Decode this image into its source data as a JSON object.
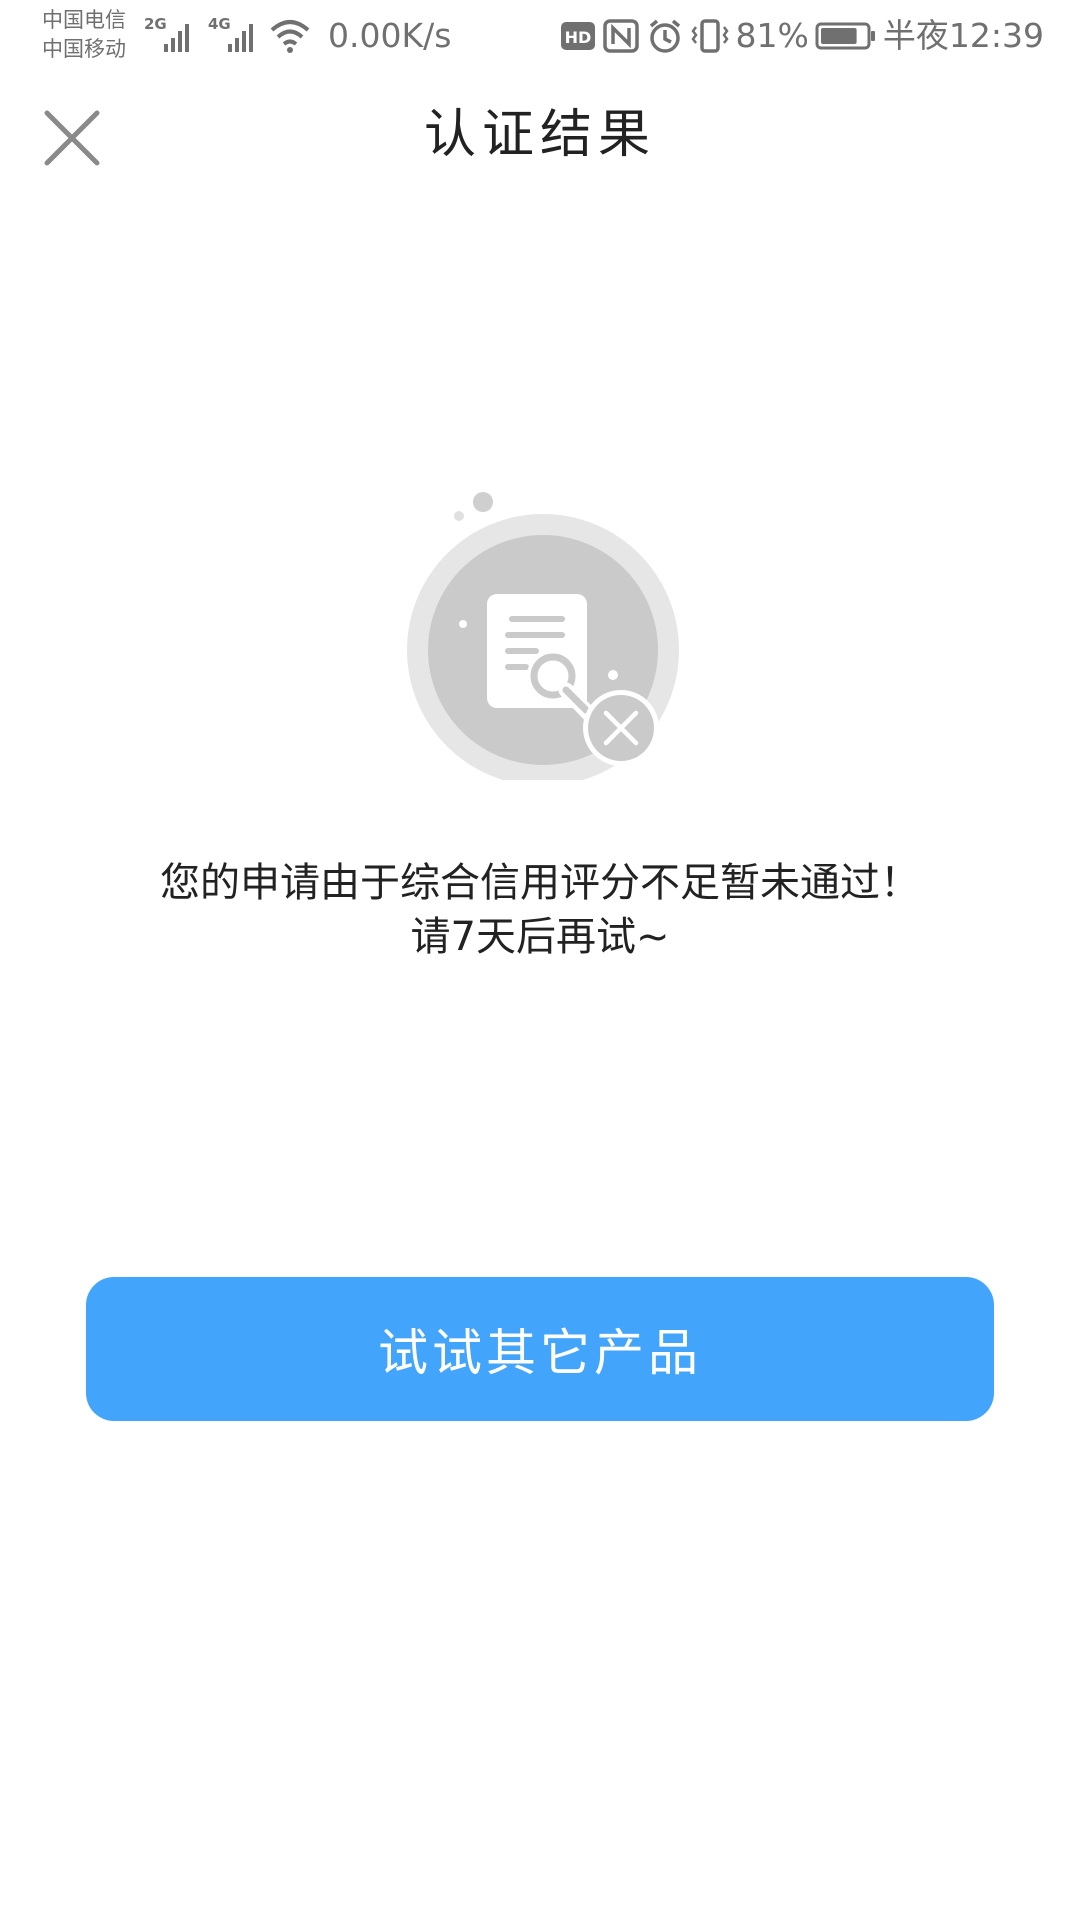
{
  "status_bar": {
    "carrier_1": "中国电信",
    "carrier_2": "中国移动",
    "network_1": "2G",
    "network_2": "4G",
    "net_speed": "0.00K/s",
    "hd_badge": "HD",
    "battery_percent": "81%",
    "battery_level": 0.81,
    "time": "半夜12:39",
    "icons": [
      "signal-icon",
      "wifi-icon",
      "hd-icon",
      "nfc-icon",
      "alarm-icon",
      "vibrate-icon",
      "battery-icon"
    ]
  },
  "nav": {
    "title": "认证结果",
    "close_icon": "close-icon"
  },
  "illustration": {
    "icon": "document-search-failed-icon"
  },
  "message": {
    "line_1": "您的申请由于综合信用评分不足暂未通过！",
    "line_2": "请7天后再试~"
  },
  "primary_button": {
    "label": "试试其它产品"
  },
  "colors": {
    "accent": "#42a5fb",
    "text": "#222222",
    "icon_gray": "#c8c8c8",
    "status_gray": "#707070"
  }
}
